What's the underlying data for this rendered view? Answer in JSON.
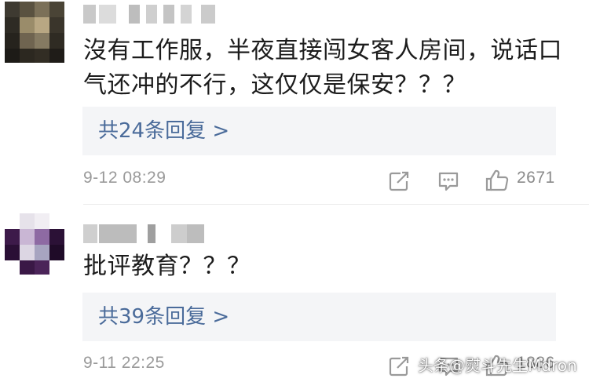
{
  "comments": [
    {
      "text": "沒有工作服，半夜直接闯女客人房间，说话口气还冲的不行，这仅仅是保安？？？",
      "reply_label": "共24条回复 >",
      "time": "9-12 08:29",
      "like_count": "2671"
    },
    {
      "text": "批评教育？？？",
      "reply_label": "共39条回复 >",
      "time": "9-11 22:25",
      "like_count": "1886"
    }
  ],
  "watermark": "头条@熨斗先生Mdron",
  "colors": {
    "link": "#4a6b9a",
    "reply_bg": "#f4f5f7",
    "meta": "#9a9a9a"
  },
  "icons": [
    "share-icon",
    "comment-icon",
    "like-icon"
  ]
}
